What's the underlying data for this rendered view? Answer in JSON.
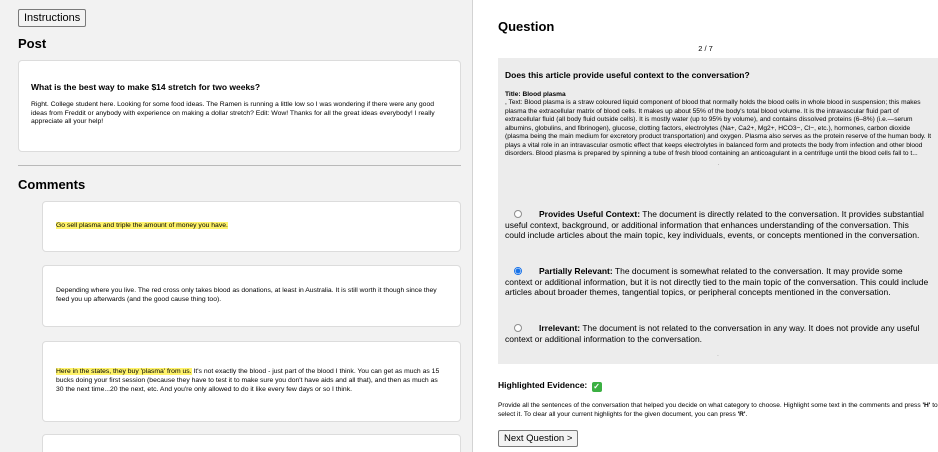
{
  "left": {
    "instructions_label": "Instructions",
    "post_heading": "Post",
    "post": {
      "title": "What is the best way to make $14 stretch for two weeks?",
      "body": "Right. College student here. Looking for some food ideas. The Ramen is running a little low so I was wondering if there were any good ideas from Freddit or anybody with experience on making a dollar stretch? Edit: Wow! Thanks for all the great ideas everybody! I really appreciate all your help!"
    },
    "comments_heading": "Comments",
    "comments": [
      {
        "highlight": "Go sell plasma and triple the amount of money you have.",
        "rest": ""
      },
      {
        "highlight": "",
        "rest": "Depending where you live. The red cross only takes blood as donations, at least in Australia. It is still worth it though since they feed you up afterwards (and the good cause thing too)."
      },
      {
        "highlight": "Here in the states, they buy 'plasma' from us.",
        "rest": " It's not exactly the blood - just part of the blood I think. You can get as much as 15 bucks doing your first session (because they have to test it to make sure you don't have aids and all that), and then as much as 30 the next time...20 the next, etc. And you're only allowed to do it like every few days or so I think."
      },
      {
        "highlight": "",
        "rest": ""
      }
    ]
  },
  "right": {
    "question_heading": "Question",
    "counter": "2 / 7",
    "question": "Does this article provide useful context to the conversation?",
    "document": {
      "title": "Title: Blood plasma",
      "text": ", Text: Blood plasma is a straw coloured liquid component of blood that normally holds the blood cells in whole blood in suspension; this makes plasma the extracellular matrix of blood cells. It makes up about 55% of the body's total blood volume. It is the intravascular fluid part of extracellular fluid (all body fluid outside cells). It is mostly water (up to 95% by volume), and contains dissolved proteins (6–8%) (i.e.—serum albumins, globulins, and fibrinogen), glucose, clotting factors, electrolytes (Na+, Ca2+, Mg2+, HCO3−, Cl−, etc.), hormones, carbon dioxide (plasma being the main medium for excretory product transportation) and oxygen. Plasma also serves as the protein reserve of the human body. It plays a vital role in an intravascular osmotic effect that keeps electrolytes in balanced form and protects the body from infection and other blood disorders. Blood plasma is prepared by spinning a tube of fresh blood containing an anticoagulant in a centrifuge until the blood cells fall to t..."
    },
    "options": [
      {
        "label": "Provides Useful Context:",
        "desc": " The document is directly related to the conversation. It provides substantial useful context, background, or additional information that enhances understanding of the conversation. This could include articles about the main topic, key individuals, events, or concepts mentioned in the conversation.",
        "checked": false
      },
      {
        "label": "Partially Relevant:",
        "desc": " The document is somewhat related to the conversation. It may provide some context or additional information, but it is not directly tied to the main topic of the conversation. This could include articles about broader themes, tangential topics, or peripheral concepts mentioned in the conversation.",
        "checked": true
      },
      {
        "label": "Irrelevant:",
        "desc": " The document is not related to the conversation in any way. It does not provide any useful context or additional information to the conversation.",
        "checked": false
      }
    ],
    "evidence_heading": "Highlighted Evidence:",
    "evidence_icon": "check-mark-icon",
    "evidence_text_prefix": "Provide all the sentences of the conversation that helped you decide on what category to choose. Highlight some text in the comments and press ",
    "evidence_key_select": "'H'",
    "evidence_text_middle": " to select it. To clear all your current highlights for the given document, you can press ",
    "evidence_key_clear": "'R'",
    "evidence_text_suffix": ".",
    "next_label": "Next Question >"
  },
  "colors": {
    "highlight": "#fff36a",
    "radio_selected": "#1a73e8",
    "check_icon": "#3cb043",
    "pane_bg": "#f2f2f2",
    "question_box_bg": "#ececec"
  }
}
